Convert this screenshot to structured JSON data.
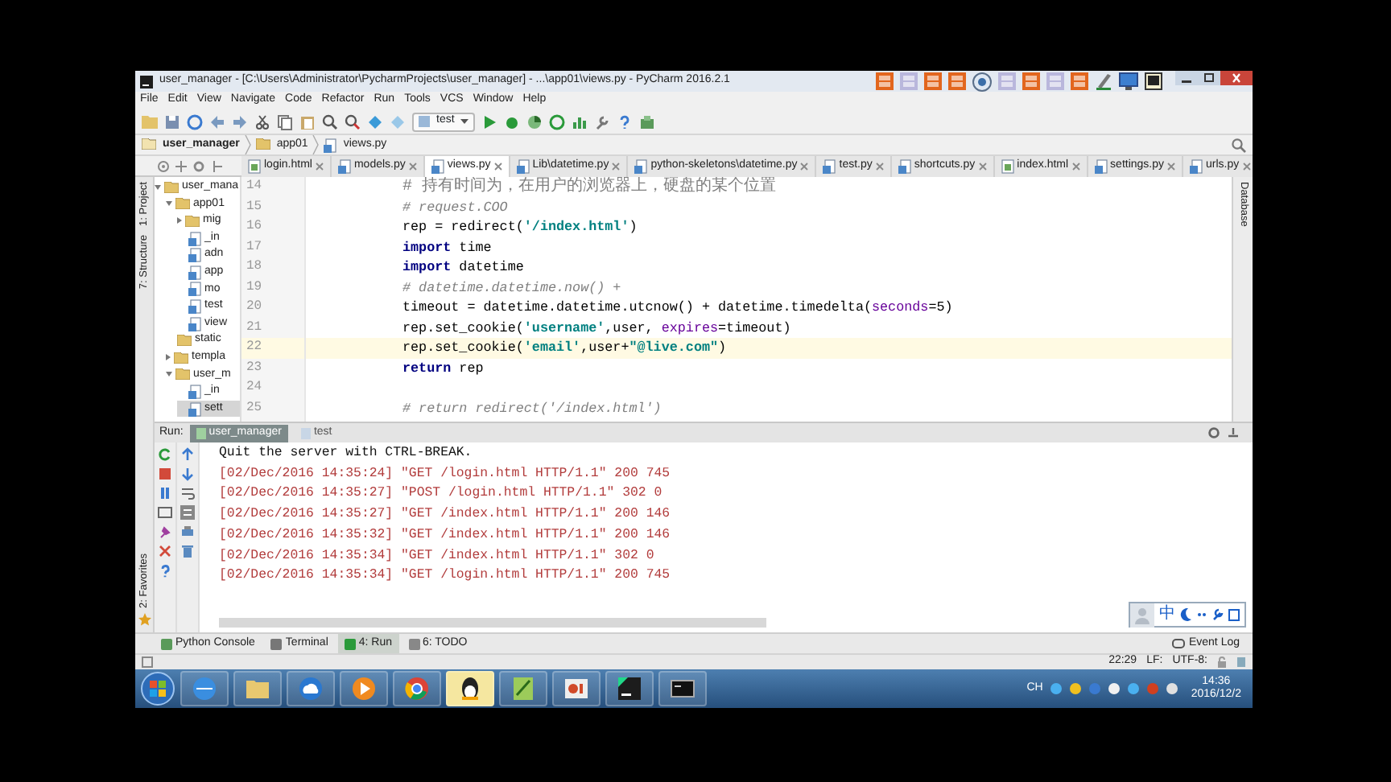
{
  "window": {
    "title": "user_manager - [C:\\Users\\Administrator\\PycharmProjects\\user_manager] - ...\\app01\\views.py - PyCharm 2016.2.1"
  },
  "menu": [
    "File",
    "Edit",
    "View",
    "Navigate",
    "Code",
    "Refactor",
    "Run",
    "Tools",
    "VCS",
    "Window",
    "Help"
  ],
  "run_config": "test",
  "breadcrumbs": [
    {
      "label": "user_manager",
      "kind": "project"
    },
    {
      "label": "app01",
      "kind": "folder"
    },
    {
      "label": "views.py",
      "kind": "python"
    }
  ],
  "editor_tabs": [
    {
      "label": "login.html",
      "kind": "html",
      "selected": false
    },
    {
      "label": "models.py",
      "kind": "python",
      "selected": false
    },
    {
      "label": "views.py",
      "kind": "python",
      "selected": true
    },
    {
      "label": "Lib\\datetime.py",
      "kind": "python",
      "selected": false
    },
    {
      "label": "python-skeletons\\datetime.py",
      "kind": "python",
      "selected": false
    },
    {
      "label": "test.py",
      "kind": "python",
      "selected": false
    },
    {
      "label": "shortcuts.py",
      "kind": "python",
      "selected": false
    },
    {
      "label": "index.html",
      "kind": "html",
      "selected": false
    },
    {
      "label": "settings.py",
      "kind": "python",
      "selected": false
    },
    {
      "label": "urls.py",
      "kind": "python",
      "selected": false
    }
  ],
  "left_tool_windows": {
    "top": [
      "1: Project",
      "7: Structure"
    ],
    "bottom": [
      "2: Favorites"
    ]
  },
  "right_tool_windows": [
    "Database"
  ],
  "project_tree": [
    {
      "label": "user_mana",
      "kind": "folder",
      "expanded": true,
      "selected": false,
      "children": [
        {
          "label": "app01",
          "kind": "folder",
          "expanded": true,
          "selected": false,
          "children": [
            {
              "label": "mig",
              "kind": "folder",
              "expanded": false,
              "selected": false
            },
            {
              "label": "_in",
              "kind": "python",
              "selected": false
            },
            {
              "label": "adn",
              "kind": "python",
              "selected": false
            },
            {
              "label": "app",
              "kind": "python",
              "selected": false
            },
            {
              "label": "mo",
              "kind": "python",
              "selected": false
            },
            {
              "label": "test",
              "kind": "python",
              "selected": false
            },
            {
              "label": "view",
              "kind": "python",
              "selected": false
            }
          ]
        },
        {
          "label": "static",
          "kind": "folder",
          "selected": false
        },
        {
          "label": "templa",
          "kind": "folder",
          "expanded": false,
          "selected": false
        },
        {
          "label": "user_m",
          "kind": "folder",
          "expanded": true,
          "selected": false,
          "children": [
            {
              "label": "_in",
              "kind": "python",
              "selected": false
            },
            {
              "label": "sett",
              "kind": "python",
              "selected": true
            }
          ]
        }
      ]
    }
  ],
  "code_lines": [
    {
      "number": "14",
      "current": false,
      "tokens": [
        {
          "text": "# 持有时间为，在用户的浏览器上，硬盘的某个位置",
          "kind": "comment"
        }
      ]
    },
    {
      "number": "15",
      "current": false,
      "tokens": [
        {
          "text": "# request.COO",
          "kind": "comment"
        }
      ]
    },
    {
      "number": "16",
      "current": false,
      "tokens": [
        {
          "text": "rep = redirect(",
          "kind": "plain"
        },
        {
          "text": "'/index.html'",
          "kind": "string"
        },
        {
          "text": ")",
          "kind": "plain"
        }
      ]
    },
    {
      "number": "17",
      "current": false,
      "tokens": [
        {
          "text": "import",
          "kind": "keyword"
        },
        {
          "text": " time",
          "kind": "plain"
        }
      ]
    },
    {
      "number": "18",
      "current": false,
      "tokens": [
        {
          "text": "import",
          "kind": "keyword"
        },
        {
          "text": " datetime",
          "kind": "plain"
        }
      ]
    },
    {
      "number": "19",
      "current": false,
      "tokens": [
        {
          "text": "# datetime.datetime.now() +",
          "kind": "comment"
        }
      ]
    },
    {
      "number": "20",
      "current": false,
      "tokens": [
        {
          "text": "timeout = datetime.datetime.utcnow() + datetime.timedelta(",
          "kind": "plain"
        },
        {
          "text": "seconds",
          "kind": "kwarg"
        },
        {
          "text": "=5)",
          "kind": "plain"
        }
      ]
    },
    {
      "number": "21",
      "current": false,
      "tokens": [
        {
          "text": "rep.set_cookie(",
          "kind": "plain"
        },
        {
          "text": "'username'",
          "kind": "string"
        },
        {
          "text": ",user, ",
          "kind": "plain"
        },
        {
          "text": "expires",
          "kind": "kwarg"
        },
        {
          "text": "=timeout)",
          "kind": "plain"
        }
      ]
    },
    {
      "number": "22",
      "current": true,
      "tokens": [
        {
          "text": "rep.set_cookie(",
          "kind": "plain"
        },
        {
          "text": "'email'",
          "kind": "string"
        },
        {
          "text": ",user+",
          "kind": "plain"
        },
        {
          "text": "\"@live.com\"",
          "kind": "string"
        },
        {
          "text": ")",
          "kind": "plain"
        }
      ]
    },
    {
      "number": "23",
      "current": false,
      "tokens": [
        {
          "text": "return",
          "kind": "keyword"
        },
        {
          "text": " rep",
          "kind": "plain"
        }
      ]
    },
    {
      "number": "24",
      "current": false
    },
    {
      "number": "25",
      "current": false,
      "tokens": [
        {
          "text": "# return redirect('/index.html')",
          "kind": "comment"
        }
      ]
    }
  ],
  "run_panel": {
    "label": "Run:",
    "tabs": [
      {
        "label": "user_manager",
        "selected": true
      },
      {
        "label": "test",
        "selected": false
      }
    ],
    "lines": [
      {
        "text": "Quit the server with CTRL-BREAK.",
        "kind": "stdout"
      },
      {
        "text": "[02/Dec/2016 14:35:24] \"GET /login.html HTTP/1.1\" 200 745",
        "kind": "stderr"
      },
      {
        "text": "[02/Dec/2016 14:35:27] \"POST /login.html HTTP/1.1\" 302 0",
        "kind": "stderr"
      },
      {
        "text": "[02/Dec/2016 14:35:27] \"GET /index.html HTTP/1.1\" 200 146",
        "kind": "stderr"
      },
      {
        "text": "[02/Dec/2016 14:35:32] \"GET /index.html HTTP/1.1\" 200 146",
        "kind": "stderr"
      },
      {
        "text": "[02/Dec/2016 14:35:34] \"GET /index.html HTTP/1.1\" 302 0",
        "kind": "stderr"
      },
      {
        "text": "[02/Dec/2016 14:35:34] \"GET /login.html HTTP/1.1\" 200 745",
        "kind": "stderr"
      }
    ]
  },
  "ime_bar": {
    "label": "中"
  },
  "bottom_tools": [
    {
      "label": "Python Console",
      "selected": false
    },
    {
      "label": "Terminal",
      "selected": false
    },
    {
      "label": "4: Run",
      "selected": true
    },
    {
      "label": "6: TODO",
      "selected": false
    }
  ],
  "event_log": "Event Log",
  "status_bar": {
    "position": "22:29",
    "line_separator": "LF:",
    "encoding": "UTF-8:"
  },
  "taskbar": {
    "language": "CH",
    "time": "14:36",
    "date": "2016/12/2"
  }
}
